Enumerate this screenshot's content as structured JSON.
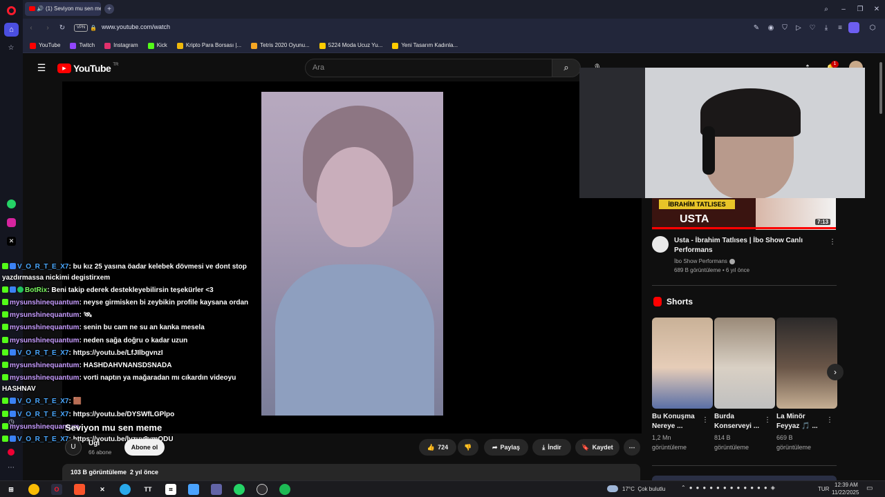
{
  "browser": {
    "tab_title": "(1) Seviyon mu sen me",
    "url": "www.youtube.com/watch",
    "vpn_label": "VPN",
    "bookmarks": [
      {
        "label": "YouTube",
        "color": "#ff0000"
      },
      {
        "label": "Twitch",
        "color": "#9146ff"
      },
      {
        "label": "Instagram",
        "color": "#e1306c"
      },
      {
        "label": "Kick",
        "color": "#53fc18"
      },
      {
        "label": "Kripto Para Borsası |...",
        "color": "#f0b90b"
      },
      {
        "label": "Tetris 2020 Oyunu...",
        "color": "#f5a623"
      },
      {
        "label": "5224 Moda Ucuz Yu...",
        "color": "#ffcc00"
      },
      {
        "label": "Yeni Tasarım Kadınla...",
        "color": "#ffcc00"
      }
    ]
  },
  "youtube": {
    "logo_text": "YouTube",
    "logo_region": "TR",
    "search_placeholder": "Ara",
    "notifications_count": "1",
    "video": {
      "title": "Seviyon mu sen meme",
      "channel": "Ugi",
      "subscribers": "66 abone",
      "subscribe_label": "Abone ol",
      "likes": "724",
      "share_label": "Paylaş",
      "download_label": "İndir",
      "save_label": "Kaydet",
      "views_date": "103 B görüntüleme  2 yıl önce"
    },
    "related": {
      "thumb_text_top": "İBRAHİM TATLISES",
      "thumb_text_bottom": "USTA",
      "duration": "7:13",
      "title": "Usta - İbrahim Tatlıses | İbo Show Canlı Performans",
      "channel": "İbo Show Performans",
      "meta": "689 B görüntüleme • 6 yıl önce"
    },
    "shorts": {
      "heading": "Shorts",
      "items": [
        {
          "title": "Bu Konuşma Nereye ...",
          "views": "1,2 Mn",
          "label": "görüntüleme"
        },
        {
          "title": "Burda Konserveyi ...",
          "views": "814 B",
          "label": "görüntüleme"
        },
        {
          "title": "La Minör Feyyaz 🎵 ...",
          "views": "669 B",
          "label": "görüntüleme"
        }
      ]
    }
  },
  "chat": [
    {
      "user": "V_O_R_T_E_X7",
      "text": ": bu kız 25 yasına öadar kelebek dövmesi ve dont stop",
      "cls": "u-blue"
    },
    {
      "user": "",
      "text": "yazdırmassa nickimi degistirxem",
      "cls": ""
    },
    {
      "user": "BotRix",
      "text": ": Beni takip ederek destekleyebilirsin teşekürler <3",
      "cls": "u-green"
    },
    {
      "user": "mysunshinequantum",
      "text": ": neyse girmisken bi zeybikin profile kaysana ordan",
      "cls": "u-purple"
    },
    {
      "user": "mysunshinequantum",
      "text": ": 🛰",
      "cls": "u-purple"
    },
    {
      "user": "mysunshinequantum",
      "text": ": senin bu cam ne su an kanka mesela",
      "cls": "u-purple"
    },
    {
      "user": "mysunshinequantum",
      "text": ": neden sağa doğru o kadar uzun",
      "cls": "u-purple"
    },
    {
      "user": "V_O_R_T_E_X7",
      "text": ": https://youtu.be/LfJIlbgvnzI",
      "cls": "u-blue"
    },
    {
      "user": "mysunshinequantum",
      "text": ": HASHDAHVNANSDSNADA",
      "cls": "u-purple"
    },
    {
      "user": "mysunshinequantum",
      "text": ": vorti naptın ya mağaradan mı cıkardın videoyu",
      "cls": "u-purple"
    },
    {
      "user": "",
      "text": "HASHNAV",
      "cls": ""
    },
    {
      "user": "V_O_R_T_E_X7",
      "text": ": 🟫",
      "cls": "u-blue"
    },
    {
      "user": "V_O_R_T_E_X7",
      "text": ": https://youtu.be/DYSWfLGPlpo",
      "cls": "u-blue"
    },
    {
      "user": "mysunshinequantum",
      "text": "",
      "cls": "u-purple"
    },
    {
      "user": "V_O_R_T_E_X7",
      "text": ": https://youtu.be/lvzuy9ymODU",
      "cls": "u-blue"
    }
  ],
  "taskbar": {
    "weather": "17°C  Çok bulutlu",
    "lang": "TUR",
    "time": "12:39 AM",
    "date": "11/22/2025"
  }
}
